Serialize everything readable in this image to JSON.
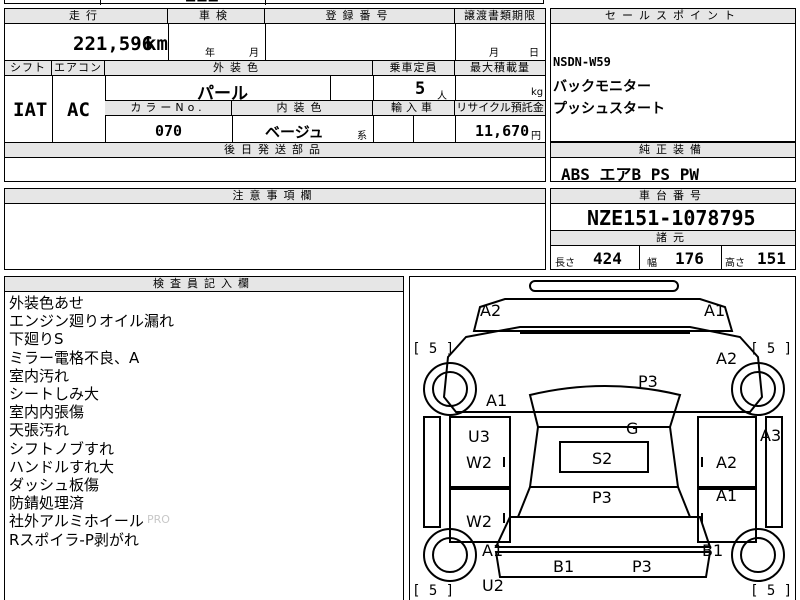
{
  "top_strip": {
    "partial_text": "■■■"
  },
  "vehicle": {
    "mileage_label": "走行",
    "mileage": "221,596",
    "mileage_unit": "km",
    "shaken_label": "車検",
    "shaken_year_unit": "年",
    "shaken_month_unit": "月",
    "registration_label": "登録番号",
    "transfer_label": "譲渡書類期限",
    "transfer_month_unit": "月",
    "transfer_day_unit": "日",
    "shift_label": "シフト",
    "shift": "IAT",
    "aircon_label": "エアコン",
    "aircon": "AC",
    "exterior_color_label": "外装色",
    "exterior_color": "パール",
    "capacity_label": "乗車定員",
    "capacity": "5",
    "capacity_unit": "人",
    "max_load_label": "最大積載量",
    "max_load_unit": "kg",
    "color_no_label": "カラーNo.",
    "color_no": "070",
    "interior_color_label": "内装色",
    "interior_color": "ベージュ",
    "interior_color_suffix": "系",
    "import_label": "輸入車",
    "recycle_label": "リサイクル預託金",
    "recycle_fee": "11,670",
    "recycle_unit": "円",
    "postship_label": "後日発送部品"
  },
  "sales_points": {
    "header": "セールスポイント",
    "items": [
      "NSDN-W59",
      "バックモニター",
      "プッシュスタート"
    ]
  },
  "equipment": {
    "header": "純正装備",
    "items": "ABS エアB PS PW"
  },
  "notes": {
    "header": "注意事項欄"
  },
  "chassis": {
    "header": "車台番号",
    "number": "NZE151-1078795"
  },
  "dimensions": {
    "header": "諸元",
    "length_label": "長さ",
    "length": "424",
    "width_label": "幅",
    "width": "176",
    "height_label": "高さ",
    "height": "151"
  },
  "inspector": {
    "header": "検査員記入欄",
    "remarks": [
      "外装色あせ",
      "エンジン廻りオイル漏れ",
      "下廻りS",
      "ミラー電格不良、A",
      "室内汚れ",
      "シートしみ大",
      "室内内張傷",
      "天張汚れ",
      "シフトノブすれ",
      "ハンドルすれ大",
      "ダッシュ板傷",
      "防錆処理済",
      "社外アルミホイール",
      "Rスポイラ-P剥がれ"
    ],
    "watermark": "PRO"
  },
  "diagram": {
    "marks": [
      "A2",
      "A1",
      "A2",
      "P3",
      "A1",
      "G",
      "A3",
      "U3",
      "S2",
      "W2",
      "A2",
      "P3",
      "A1",
      "W2",
      "A1",
      "B1",
      "B1",
      "P3",
      "U2"
    ],
    "tire_labels": [
      "[ 5 ]",
      "[ 5 ]",
      "[ 5 ]",
      "[ 5 ]"
    ]
  },
  "colors": {
    "header_bg": "#e6e6e6",
    "ink": "#000000"
  }
}
